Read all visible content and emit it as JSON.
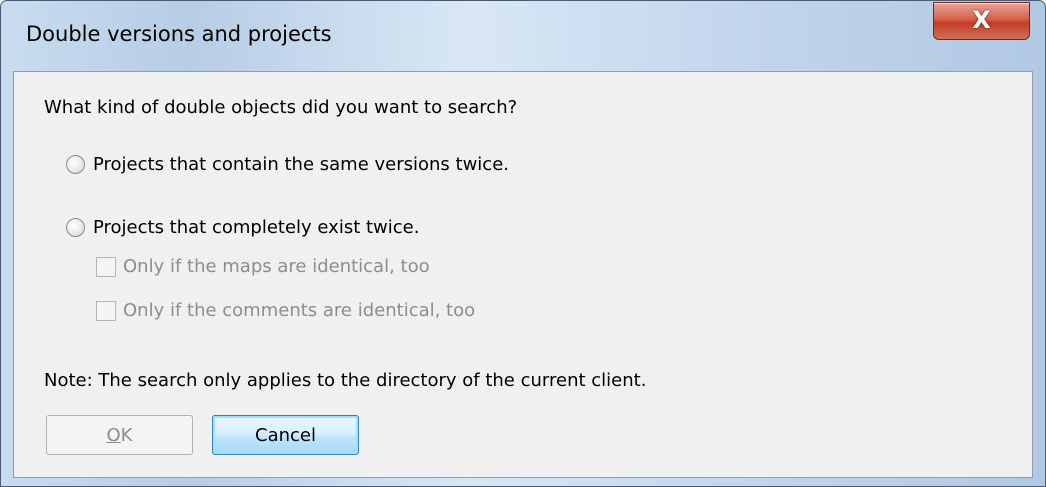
{
  "window": {
    "title": "Double versions and projects",
    "close_label": "X"
  },
  "dialog": {
    "question": "What kind of double objects did you want to search?",
    "options": [
      {
        "label": "Projects that contain the same versions twice.",
        "selected": false
      },
      {
        "label": "Projects that completely exist twice.",
        "selected": false
      }
    ],
    "sub_options": [
      {
        "label": "Only if the maps are identical, too",
        "checked": false,
        "enabled": false
      },
      {
        "label": "Only if the comments are identical, too",
        "checked": false,
        "enabled": false
      }
    ],
    "note": "Note: The search only applies to the directory of the current client."
  },
  "buttons": {
    "ok_mnemonic": "O",
    "ok_rest": "K",
    "ok_enabled": false,
    "cancel_label": "Cancel"
  },
  "colors": {
    "titlebar": "#c9dcef",
    "client_bg": "#f0f0f0",
    "close_red": "#c23d26",
    "disabled_text": "#8d8d8d",
    "focus_border": "#3c7fb1"
  },
  "icons": {
    "close": "close-icon",
    "radio": "radio-button",
    "checkbox": "checkbox"
  }
}
